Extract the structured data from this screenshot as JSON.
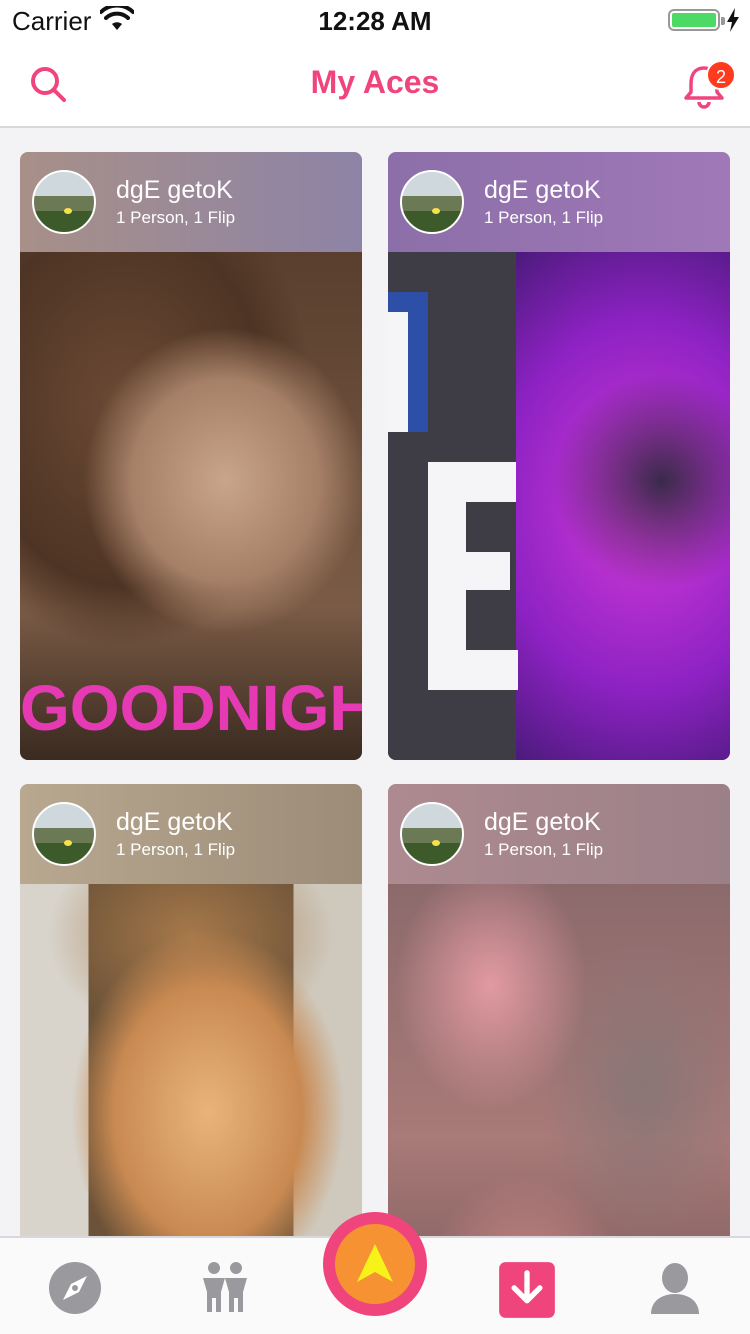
{
  "status_bar": {
    "carrier": "Carrier",
    "time": "12:28 AM",
    "battery_color": "#4cd964"
  },
  "nav": {
    "title": "My Aces",
    "search_icon": "search-icon",
    "bell_icon": "bell-icon",
    "notification_count": "2",
    "accent_color": "#f0457c"
  },
  "cards": [
    {
      "name": "dgE getoK",
      "subtitle": "1 Person, 1 Flip",
      "image": "woman-portrait-goodnight-gif"
    },
    {
      "name": "dgE getoK",
      "subtitle": "1 Person, 1 Flip",
      "image": "purple-creature-gif"
    },
    {
      "name": "dgE getoK",
      "subtitle": "1 Person, 1 Flip",
      "image": "woman-kiss-gif"
    },
    {
      "name": "dgE getoK",
      "subtitle": "1 Person, 1 Flip",
      "image": "blurred-crowd-gif"
    }
  ],
  "image_text": {
    "goodnight": "GOODNIGH"
  },
  "tabbar": {
    "items": [
      {
        "icon": "compass-icon"
      },
      {
        "icon": "people-icon"
      },
      {
        "icon": "ace-arrow-icon"
      },
      {
        "icon": "download-icon"
      },
      {
        "icon": "profile-icon"
      }
    ]
  }
}
